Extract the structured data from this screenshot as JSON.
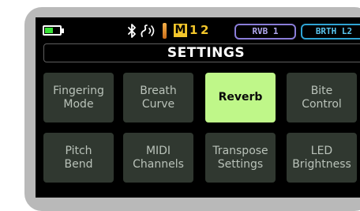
{
  "status_bar": {
    "battery_level": 0.55,
    "battery_color": "#39e236",
    "bluetooth_icon": "bluetooth-icon",
    "breath_icon": "breath-sensor-icon",
    "mouthpiece_icon": "mouthpiece-icon",
    "memory_badge": "M",
    "memory_slot_1": "1",
    "memory_slot_2": "2",
    "memory_slot_1_color": "#f3c62b",
    "memory_slot_2_color": "#f3c62b",
    "reverb_pill": "RVB 1",
    "breath_pill": "BRTH L2"
  },
  "header": {
    "title": "SETTINGS"
  },
  "menu": {
    "selected_color": "#bff789",
    "tile_color": "#303830",
    "items": [
      {
        "label": "Fingering\nMode",
        "selected": false
      },
      {
        "label": "Breath\nCurve",
        "selected": false
      },
      {
        "label": "Reverb",
        "selected": true
      },
      {
        "label": "Bite\nControl",
        "selected": false
      },
      {
        "label": "Pitch\nBend",
        "selected": false
      },
      {
        "label": "MIDI\nChannels",
        "selected": false
      },
      {
        "label": "Transpose\nSettings",
        "selected": false
      },
      {
        "label": "LED\nBrightness",
        "selected": false
      }
    ]
  }
}
